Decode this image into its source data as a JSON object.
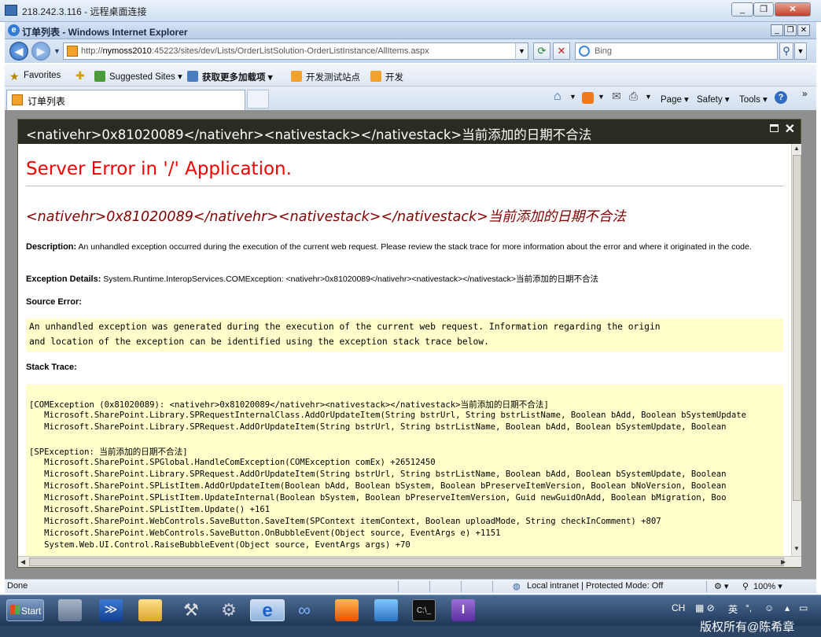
{
  "rdp": {
    "title": "218.242.3.116 - 远程桌面连接"
  },
  "ie": {
    "title": "订单列表 - Windows Internet Explorer",
    "url_prefix": "http://",
    "url_host": "nymoss2010",
    "url_rest": ":45223/sites/dev/Lists/OrderListSolution-OrderListInstance/AllItems.aspx",
    "search_placeholder": "Bing",
    "favorites_label": "Favorites",
    "suggested_sites": "Suggested Sites",
    "get_addons": "获取更多加载项",
    "fav_link1": "开发测试站点",
    "fav_link2": "开发",
    "tab_title": "订单列表",
    "tools": {
      "page": "Page",
      "safety": "Safety",
      "tools": "Tools"
    }
  },
  "dialog": {
    "header": "<nativehr>0x81020089</nativehr><nativestack></nativestack>当前添加的日期不合法",
    "server_error": "Server Error in '/' Application.",
    "error_title": "<nativehr>0x81020089</nativehr><nativestack></nativestack>当前添加的日期不合法",
    "desc_label": "Description:",
    "desc_text": "An unhandled exception occurred during the execution of the current web request. Please review the stack trace for more information about the error and where it originated in the code.",
    "exc_label": "Exception Details:",
    "exc_text": "System.Runtime.InteropServices.COMException: <nativehr>0x81020089</nativehr><nativestack></nativestack>当前添加的日期不合法",
    "source_label": "Source Error:",
    "source_lines": [
      "An unhandled exception was generated during the execution of the current web request. Information regarding the origin",
      "and location of the exception can be identified using the exception stack trace below."
    ],
    "stack_label": "Stack Trace:",
    "stack_lines": [
      "[COMException (0x81020089): <nativehr>0x81020089</nativehr><nativestack></nativestack>当前添加的日期不合法]",
      "   Microsoft.SharePoint.Library.SPRequestInternalClass.AddOrUpdateItem(String bstrUrl, String bstrListName, Boolean bAdd, Boolean bSystemUpdate",
      "   Microsoft.SharePoint.Library.SPRequest.AddOrUpdateItem(String bstrUrl, String bstrListName, Boolean bAdd, Boolean bSystemUpdate, Boolean",
      "",
      "[SPException: 当前添加的日期不合法]",
      "   Microsoft.SharePoint.SPGlobal.HandleComException(COMException comEx) +26512450",
      "   Microsoft.SharePoint.Library.SPRequest.AddOrUpdateItem(String bstrUrl, String bstrListName, Boolean bAdd, Boolean bSystemUpdate, Boolean",
      "   Microsoft.SharePoint.SPListItem.AddOrUpdateItem(Boolean bAdd, Boolean bSystem, Boolean bPreserveItemVersion, Boolean bNoVersion, Boolean",
      "   Microsoft.SharePoint.SPListItem.UpdateInternal(Boolean bSystem, Boolean bPreserveItemVersion, Guid newGuidOnAdd, Boolean bMigration, Boo",
      "   Microsoft.SharePoint.SPListItem.Update() +161",
      "   Microsoft.SharePoint.WebControls.SaveButton.SaveItem(SPContext itemContext, Boolean uploadMode, String checkInComment) +807",
      "   Microsoft.SharePoint.WebControls.SaveButton.OnBubbleEvent(Object source, EventArgs e) +1151",
      "   System.Web.UI.Control.RaiseBubbleEvent(Object source, EventArgs args) +70"
    ]
  },
  "status": {
    "done": "Done",
    "zone": "Local intranet | Protected Mode: Off",
    "zoom": "100%"
  },
  "taskbar": {
    "start": "Start",
    "lang": "CH",
    "ime": "英",
    "watermark": "版权所有@陈希章"
  }
}
